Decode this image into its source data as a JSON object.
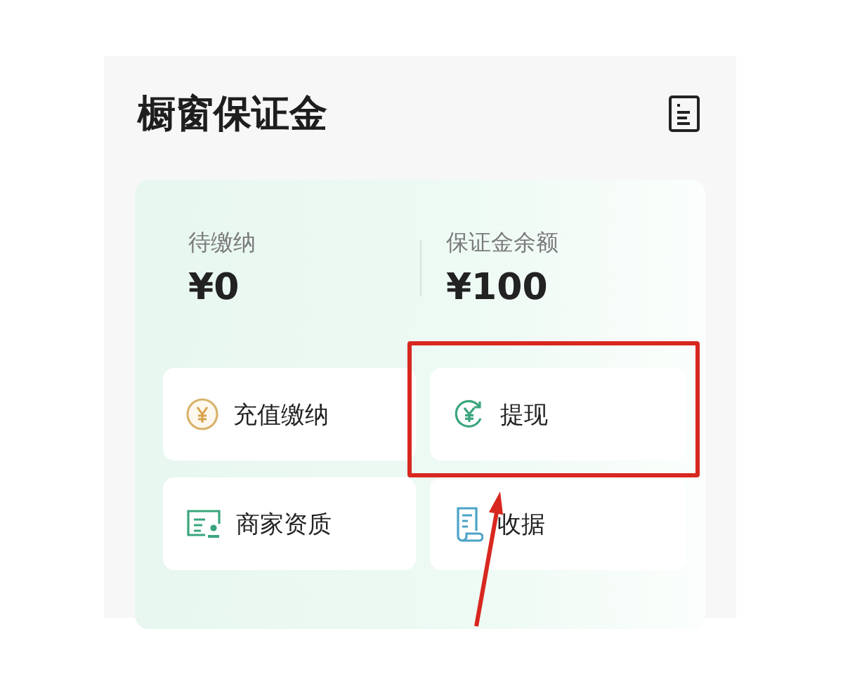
{
  "page": {
    "title": "橱窗保证金"
  },
  "stats": [
    {
      "label": "待缴纳",
      "value": "¥0"
    },
    {
      "label": "保证金余额",
      "value": "¥100"
    }
  ],
  "actions": [
    {
      "kind": "recharge",
      "label": "充值缴纳",
      "highlighted": false
    },
    {
      "kind": "withdraw",
      "label": "提现",
      "highlighted": true
    },
    {
      "kind": "qualification",
      "label": "商家资质",
      "highlighted": false
    },
    {
      "kind": "receipt",
      "label": "收据",
      "highlighted": false
    }
  ]
}
